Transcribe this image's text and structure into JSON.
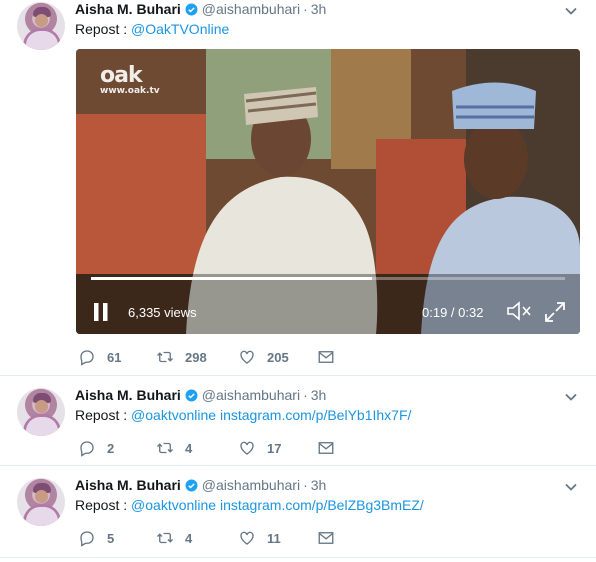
{
  "tweets": [
    {
      "name": "Aisha M. Buhari",
      "handle": "@aishambuhari",
      "dot": "·",
      "time": "3h",
      "prefix": "Repost : ",
      "mention": "@OakTVOnline",
      "url": "",
      "replies": "61",
      "retweets": "298",
      "likes": "205",
      "video": {
        "watermark_logo": "oak",
        "watermark_url": "www.oak.tv",
        "views": "6,335 views",
        "time_display": "0:19 / 0:32",
        "elapsed_seconds": 19,
        "duration_seconds": 32
      }
    },
    {
      "name": "Aisha M. Buhari",
      "handle": "@aishambuhari",
      "dot": "·",
      "time": "3h",
      "prefix": "Repost : ",
      "mention": "@oaktvonline",
      "url": "instagram.com/p/BelYb1Ihx7F/",
      "replies": "2",
      "retweets": "4",
      "likes": "17"
    },
    {
      "name": "Aisha M. Buhari",
      "handle": "@aishambuhari",
      "dot": "·",
      "time": "3h",
      "prefix": "Repost : ",
      "mention": "@oaktvonline",
      "url": "instagram.com/p/BelZBg3BmEZ/",
      "replies": "5",
      "retweets": "4",
      "likes": "11"
    }
  ],
  "colors": {
    "link": "#1b95e0",
    "muted": "#657786",
    "verified": "#1da1f2",
    "divider": "#e6ecf0"
  },
  "icons": [
    "verified-badge-icon",
    "chevron-down-icon",
    "reply-icon",
    "retweet-icon",
    "like-icon",
    "direct-message-icon",
    "pause-icon",
    "mute-icon",
    "fullscreen-icon"
  ]
}
